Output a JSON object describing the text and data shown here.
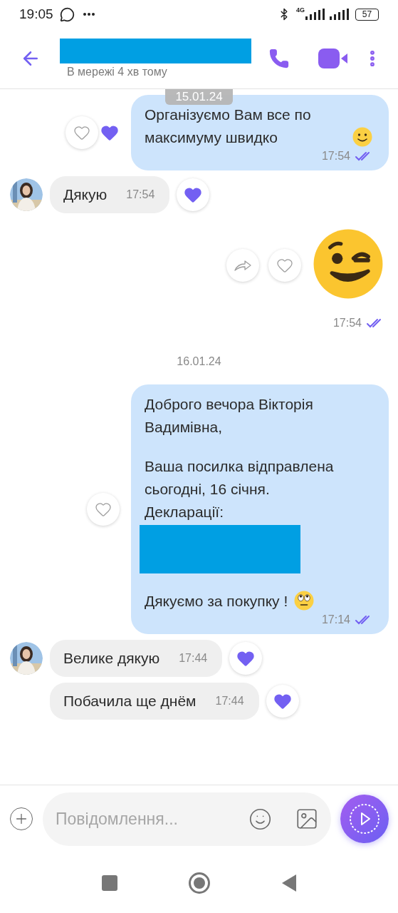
{
  "status_bar": {
    "time": "19:05",
    "network": "4G",
    "battery": "57"
  },
  "header": {
    "status": "В мережі 4 хв тому"
  },
  "floating_date": "15.01.24",
  "messages": [
    {
      "kind": "outgoing",
      "paragraphs": [
        {
          "lines": [
            "Організуємо Вам все по максимуму швидко"
          ],
          "emoji": {
            "kind": "slight_smile"
          }
        }
      ],
      "time": "17:54",
      "read": true,
      "liked": true
    },
    {
      "kind": "incoming",
      "show_avatar": true,
      "text": "Дякую",
      "time": "17:54",
      "liked": true
    },
    {
      "kind": "sticker",
      "sticker": {
        "kind": "wink"
      },
      "time": "17:54",
      "read": true,
      "liked": false
    },
    {
      "kind": "date",
      "text": "16.01.24"
    },
    {
      "kind": "outgoing",
      "paragraphs": [
        {
          "lines": [
            "Доброго вечора Вікторія Вадимівна,"
          ]
        },
        {
          "lines": [
            "Ваша посилка відправлена сьогодні, 16 січня.",
            "Декларації:"
          ],
          "redacted": true
        },
        {
          "lines": [
            "Дякуємо за покупку !"
          ],
          "emoji": {
            "kind": "rolling_eyes"
          }
        }
      ],
      "time": "17:14",
      "read": true,
      "liked": false
    },
    {
      "kind": "incoming",
      "show_avatar": true,
      "text": "Велике дякую",
      "time": "17:44",
      "liked": true
    },
    {
      "kind": "incoming",
      "show_avatar": false,
      "text": "Побачила ще днём",
      "time": "17:44",
      "liked": true
    }
  ],
  "composer": {
    "placeholder": "Повідомлення..."
  }
}
